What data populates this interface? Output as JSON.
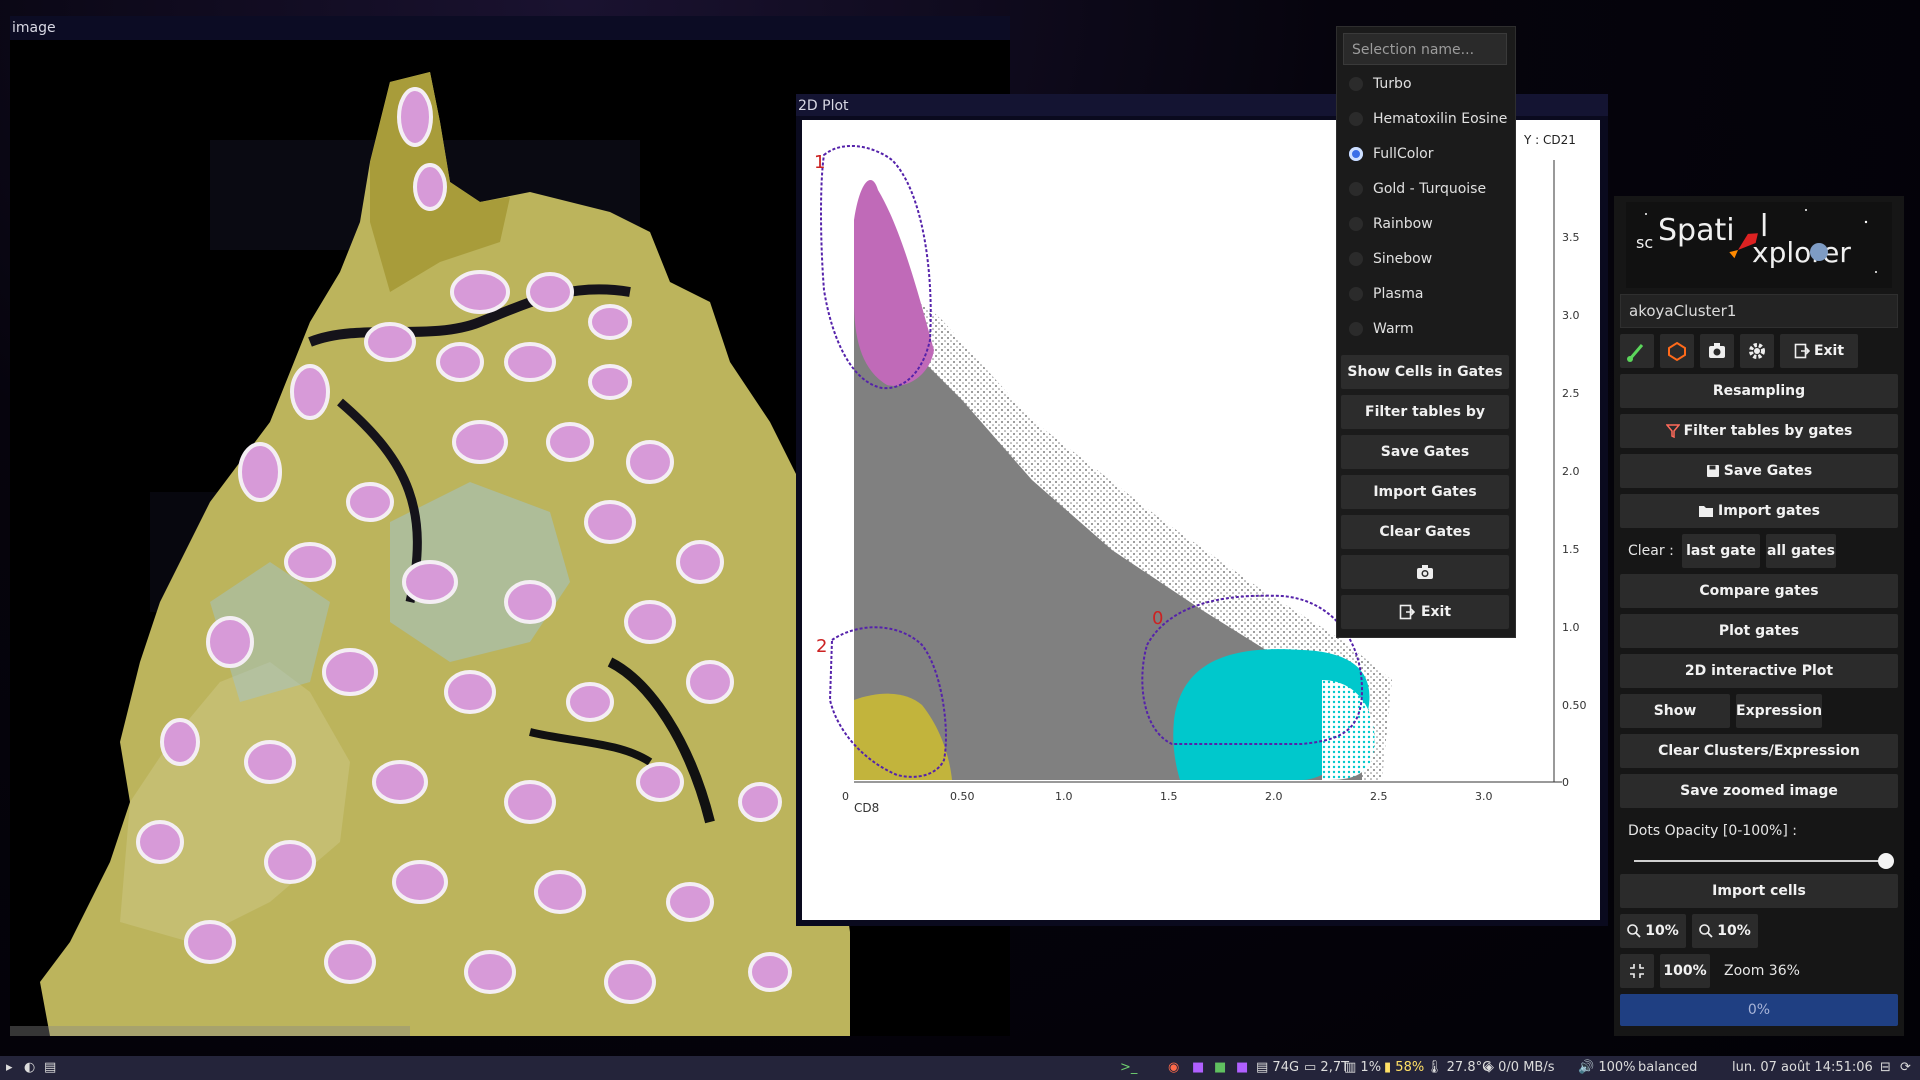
{
  "windows": {
    "image_title": "image",
    "plot_title": "2D Plot"
  },
  "plot": {
    "y_axis_label": "Y : CD21",
    "x_axis_label": "CD8",
    "x_ticks": [
      "0",
      "0.50",
      "1.0",
      "1.5",
      "2.0",
      "2.5",
      "3.0"
    ],
    "y_ticks": [
      "0",
      "0.50",
      "1.0",
      "1.5",
      "2.0",
      "2.5",
      "3.0",
      "3.5"
    ],
    "gate_labels": [
      "1",
      "2",
      "0"
    ],
    "colors": {
      "gate1": "#c06ab8",
      "gate2": "#c2b43c",
      "gate0": "#00c8cc",
      "background": "#808080",
      "outline": "#5522aa"
    }
  },
  "context_menu": {
    "search_placeholder": "Selection name...",
    "colormaps": [
      "Turbo",
      "Hematoxilin Eosine",
      "FullColor",
      "Gold - Turquoise",
      "Rainbow",
      "Sinebow",
      "Plasma",
      "Warm"
    ],
    "selected_colormap": "FullColor",
    "buttons": {
      "show_cells": "Show Cells in Gates",
      "filter_tables": "Filter tables by Gates",
      "save_gates": "Save Gates",
      "import_gates": "Import Gates",
      "clear_gates": "Clear Gates",
      "exit": "Exit"
    },
    "icons": {
      "camera": "camera-icon",
      "exit": "exit-icon"
    }
  },
  "panel": {
    "logo": {
      "prefix": "sc",
      "word1": "Spati",
      "word1b": "l",
      "word2": "xplorer",
      "o": "o"
    },
    "dataset": "akoyaCluster1",
    "exit_label": "Exit",
    "resampling": "Resampling",
    "filter_tables": "Filter tables by gates",
    "save_gates": "Save Gates",
    "import_gates": "Import gates",
    "clear_label": "Clear :",
    "last_gate": "last gate",
    "all_gates": "all gates",
    "compare_gates": "Compare gates",
    "plot_gates": "Plot gates",
    "interactive_2d": "2D interactive Plot",
    "show_clusters": "Show Clusters",
    "expression": "Expression",
    "clear_clusters": "Clear Clusters/Expression",
    "save_zoomed": "Save zoomed image",
    "opacity_label": "Dots Opacity [0-100%] :",
    "opacity_value": 1.0,
    "import_cells": "Import cells",
    "zoom_out": "10%",
    "zoom_in": "10%",
    "fit_label": "100%",
    "zoom_text": "Zoom 36%",
    "progress": "0%",
    "icons": {
      "brush": "brush-icon",
      "polygon": "polygon-icon",
      "camera": "camera-icon",
      "gear": "gear-icon",
      "exit": "exit-icon",
      "funnel": "funnel-icon",
      "save": "save-icon",
      "folder": "folder-icon",
      "zoom_out": "zoom-out-icon",
      "zoom_in": "zoom-in-icon",
      "fit": "fit-icon"
    }
  },
  "taskbar": {
    "ram": "74G",
    "disk": "2,7T",
    "cpu": "1%",
    "battery": "58%",
    "temp": "27.8°C",
    "net": "0/0 MB/s",
    "volume": "100%",
    "power_mode": "balanced",
    "datetime": "lun. 07 août 14:51:06"
  }
}
